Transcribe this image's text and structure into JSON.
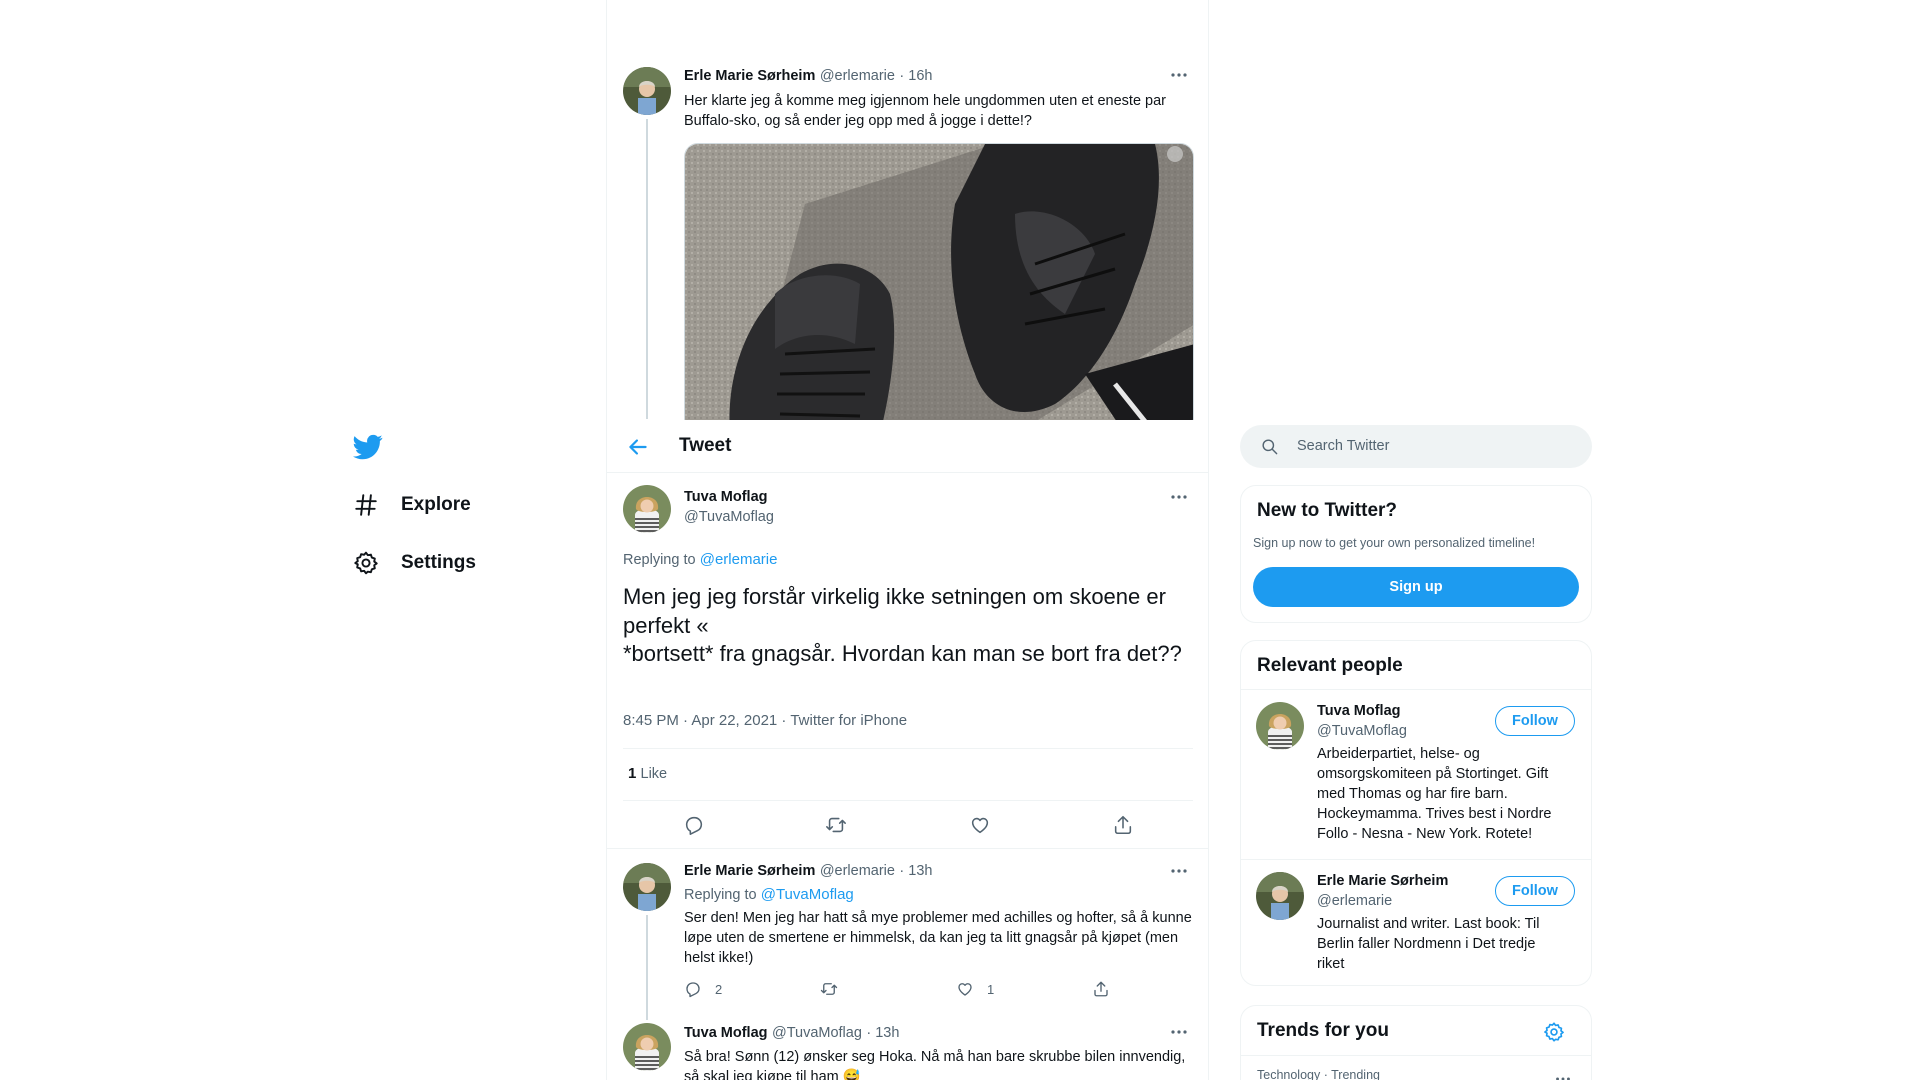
{
  "nav": {
    "explore_label": "Explore",
    "settings_label": "Settings"
  },
  "header": {
    "title": "Tweet"
  },
  "thread_parent": {
    "author_name": "Erle Marie Sørheim",
    "author_handle": "@erlemarie",
    "time": "· 16h",
    "text": "Her klarte jeg å komme meg igjennom hele ungdommen uten et eneste par Buffalo-sko, og så ender jeg opp med å jogge i dette!?"
  },
  "focal_tweet": {
    "author_name": "Tuva Moflag",
    "author_handle": "@TuvaMoflag",
    "replying_prefix": "Replying to",
    "replying_to": "@erlemarie",
    "text": "Men jeg jeg forstår virkelig ikke setningen om skoene er perfekt «\n*bortsett* fra gnagsår. Hvordan kan man se bort fra det??",
    "meta": "8:45 PM · Apr 22, 2021 · Twitter for iPhone",
    "like_count": "1",
    "like_label": "Like"
  },
  "replies": [
    {
      "author_name": "Erle Marie Sørheim",
      "author_handle": "@erlemarie",
      "time": "· 13h",
      "replying_prefix": "Replying to",
      "replying_to": "@TuvaMoflag",
      "text": "Ser den! Men jeg har hatt så mye problemer med achilles og hofter, så å kunne løpe uten de smertene er himmelsk, da kan jeg ta litt gnagsår på kjøpet (men helst ikke!)",
      "reply_count": "2",
      "like_count": "1"
    },
    {
      "author_name": "Tuva Moflag",
      "author_handle": "@TuvaMoflag",
      "time": "· 13h",
      "text": "Så bra! Sønn (12) ønsker seg Hoka. Nå må han bare skrubbe bilen innvendig, så skal jeg kjøpe til ham 😅"
    }
  ],
  "search": {
    "placeholder": "Search Twitter"
  },
  "new_to_twitter": {
    "title": "New to Twitter?",
    "subtitle": "Sign up now to get your own personalized timeline!",
    "button": "Sign up"
  },
  "relevant_people": {
    "title": "Relevant people",
    "people": [
      {
        "name": "Tuva Moflag",
        "handle": "@TuvaMoflag",
        "bio": "Arbeiderpartiet, helse- og omsorgskomiteen på Stortinget. Gift med Thomas og har fire barn. Hockeymamma. Trives best i Nordre Follo - Nesna - New York. Rotete!",
        "follow": "Follow"
      },
      {
        "name": "Erle Marie Sørheim",
        "handle": "@erlemarie",
        "bio": "Journalist and writer. Last book: Til Berlin faller Nordmenn i Det tredje riket",
        "follow": "Follow"
      }
    ]
  },
  "trends": {
    "title": "Trends for you",
    "first_category": "Technology · Trending"
  },
  "colors": {
    "accent": "#1d9bf0",
    "muted": "#536471",
    "border": "#eff3f4"
  }
}
